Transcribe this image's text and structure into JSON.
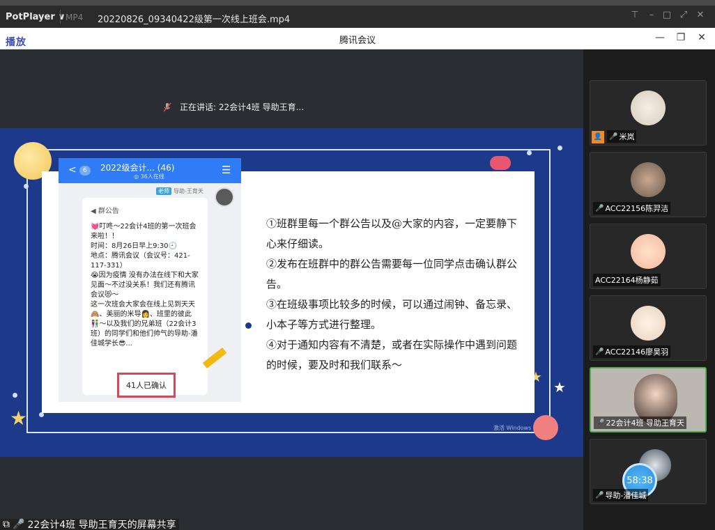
{
  "potplayer": {
    "brand": "PotPlayer",
    "format": "MP4",
    "file_name": "20220826_09340422级第一次线上班会.mp4"
  },
  "meeting": {
    "play_label": "播放",
    "title": "腾讯会议",
    "speaking": "正在讲话: 22会计4班 导助王育..."
  },
  "slide": {
    "chat": {
      "badge": "6",
      "group_name": "2022级会计... (46)",
      "online": "◎ 36人在线",
      "sender_tag": "老师",
      "sender_name": "导助-王育天",
      "notice_title": "群公告",
      "notice_body": "💓叮咚～22会计4班的第一次班会来啦！！\n时间：8月26日早上9:30🕘\n地点：腾讯会议（会议号：421-117-331）\n😭因为疫情 没有办法在线下和大家见面～不过没关系！我们还有腾讯会议😻～\n这一次班会大家会在线上见到天天🙈、美丽的米导👩、班里的彼此👫～以及我们的兄弟班（22会计3班）的同学们和他们帅气的导助-潘佳城学长😎...",
      "confirmed": "41人已确认"
    },
    "points": [
      "①班群里每一个群公告以及@大家的内容，一定要静下心来仔细读。",
      "②发布在班群中的群公告需要每一位同学点击确认群公告。",
      "③在班级事项比较多的时候，可以通过闹钟、备忘录、小本子等方式进行整理。",
      "④对于通知内容有不清楚，或者在实际操作中遇到问题的时候，要及时和我们联系～"
    ],
    "watermark": "激活 Windows"
  },
  "participants": [
    {
      "name": "米岚",
      "mic": "off",
      "host": true
    },
    {
      "name": "ACC22156陈羿洁",
      "mic": "off"
    },
    {
      "name": "ACC22164杨静茹",
      "mic": "none"
    },
    {
      "name": "ACC22146廖昊羽",
      "mic": "off"
    },
    {
      "name": "22会计4班 导助王育天",
      "mic": "on",
      "active": true
    },
    {
      "name": "导助-潘佳城",
      "mic": "off",
      "timer": "58:38"
    }
  ],
  "share_bar": {
    "label": "22会计4班 导助王育天的屏幕共享"
  }
}
